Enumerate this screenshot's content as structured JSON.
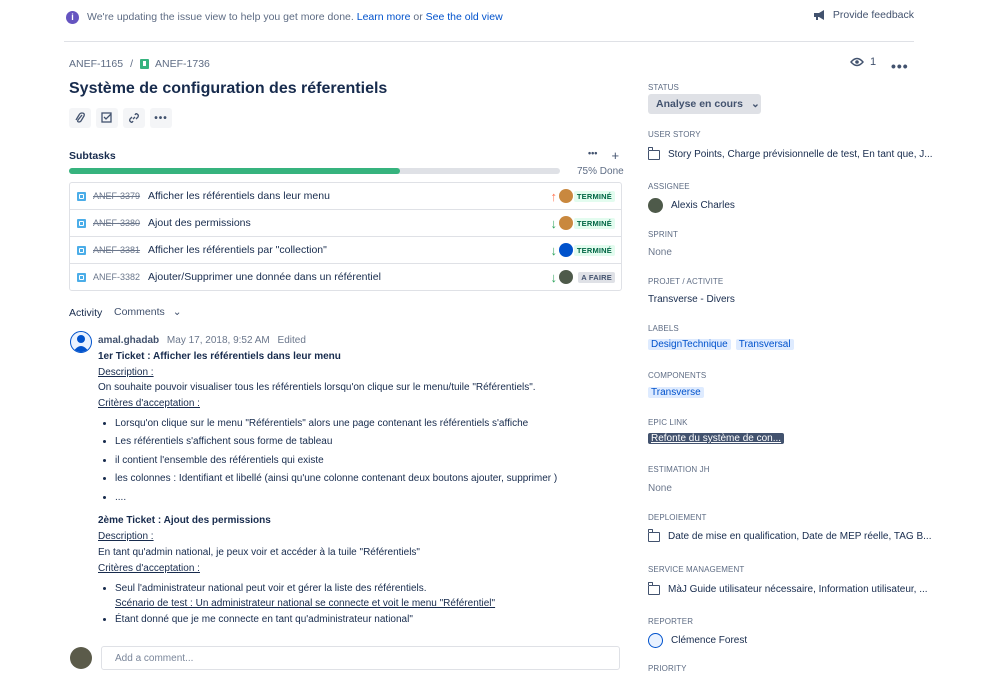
{
  "banner": {
    "text": "We're updating the issue view to help you get more done.",
    "learn_more": "Learn more",
    "or": "or",
    "old_view": "See the old view",
    "feedback": "Provide feedback"
  },
  "breadcrumb": {
    "parent": "ANEF-1165",
    "separator": "/",
    "current": "ANEF-1736"
  },
  "issue": {
    "title": "Système de configuration des réferentiels"
  },
  "watchers": {
    "count": "1"
  },
  "subtasks": {
    "heading": "Subtasks",
    "progress_label": "75% Done",
    "progress_fraction": 0.75,
    "items": [
      {
        "key": "ANEF-3379",
        "summary": "Afficher les référentiels dans leur menu",
        "priority": "↑",
        "status": "TERMINÉ"
      },
      {
        "key": "ANEF-3380",
        "summary": "Ajout des permissions",
        "priority": "↓",
        "status": "TERMINÉ"
      },
      {
        "key": "ANEF-3381",
        "summary": "Afficher les référentiels par \"collection\"",
        "priority": "↓",
        "status": "TERMINÉ"
      },
      {
        "key": "ANEF-3382",
        "summary": "Ajouter/Supprimer une donnée dans un référentiel",
        "priority": "↓",
        "status": "A FAIRE"
      }
    ]
  },
  "activity": {
    "heading": "Activity",
    "filter": "Comments",
    "comment": {
      "author": "amal.ghadab",
      "date": "May 17, 2018, 9:52 AM",
      "edited": "Edited",
      "t1_title": "1er Ticket : Afficher les référentiels dans leur menu",
      "t1_desc_label": "Description :",
      "t1_desc": "On souhaite pouvoir visualiser tous les référentiels lorsqu'on clique sur le menu/tuile \"Référentiels\".",
      "t1_crit_label": "Critères d'acceptation :",
      "t1_bullets": [
        "Lorsqu'on clique sur le menu \"Référentiels\" alors une page contenant les référentiels s'affiche",
        "Les référentiels s'affichent sous forme de tableau",
        "il contient l'ensemble des référentiels qui existe",
        "les colonnes : Identifiant et libellé (ainsi qu'une colonne contenant deux boutons ajouter, supprimer )",
        "...."
      ],
      "t2_title": "2ème Ticket : Ajout des permissions",
      "t2_desc_label": "Description :",
      "t2_desc": "En tant qu'admin national, je peux voir et accéder à la tuile \"Référentiels\"",
      "t2_crit_label": "Critères d'acceptation :",
      "t2_b1": "Seul l'administrateur national peut voir et gérer la liste des référentiels.",
      "t2_b1_sub": "Scénario de test : Un administrateur national se connecte et voit le menu \"Référentiel\"",
      "t2_b2": "Étant donné que je me connecte en tant qu'administrateur national\""
    },
    "add_placeholder": "Add a comment..."
  },
  "fields": {
    "status_label": "STATUS",
    "status_value": "Analyse en cours",
    "user_story_label": "USER STORY",
    "user_story_value": "Story Points, Charge prévisionnelle de test, En tant que, J...",
    "assignee_label": "ASSIGNEE",
    "assignee_value": "Alexis Charles",
    "sprint_label": "SPRINT",
    "sprint_value": "None",
    "projet_label": "PROJET / ACTIVITE",
    "projet_value": "Transverse - Divers",
    "labels_label": "LABELS",
    "labels": [
      "DesignTechnique",
      "Transversal"
    ],
    "components_label": "COMPONENTS",
    "components": [
      "Transverse"
    ],
    "epic_label": "EPIC LINK",
    "epic_value": "Refonte du système de con...",
    "estimation_label": "ESTIMATION JH",
    "estimation_value": "None",
    "deploiement_label": "DEPLOIEMENT",
    "deploiement_value": "Date de mise en qualification, Date de MEP réelle, TAG B...",
    "service_label": "SERVICE MANAGEMENT",
    "service_value": "MàJ Guide utilisateur nécessaire, Information utilisateur, ...",
    "reporter_label": "REPORTER",
    "reporter_value": "Clémence Forest",
    "priority_label": "PRIORITY"
  },
  "colors": {
    "accent": "#0052cc",
    "progress": "#36b37e",
    "done_badge": "#e3fcef",
    "epic": "#42526e"
  }
}
